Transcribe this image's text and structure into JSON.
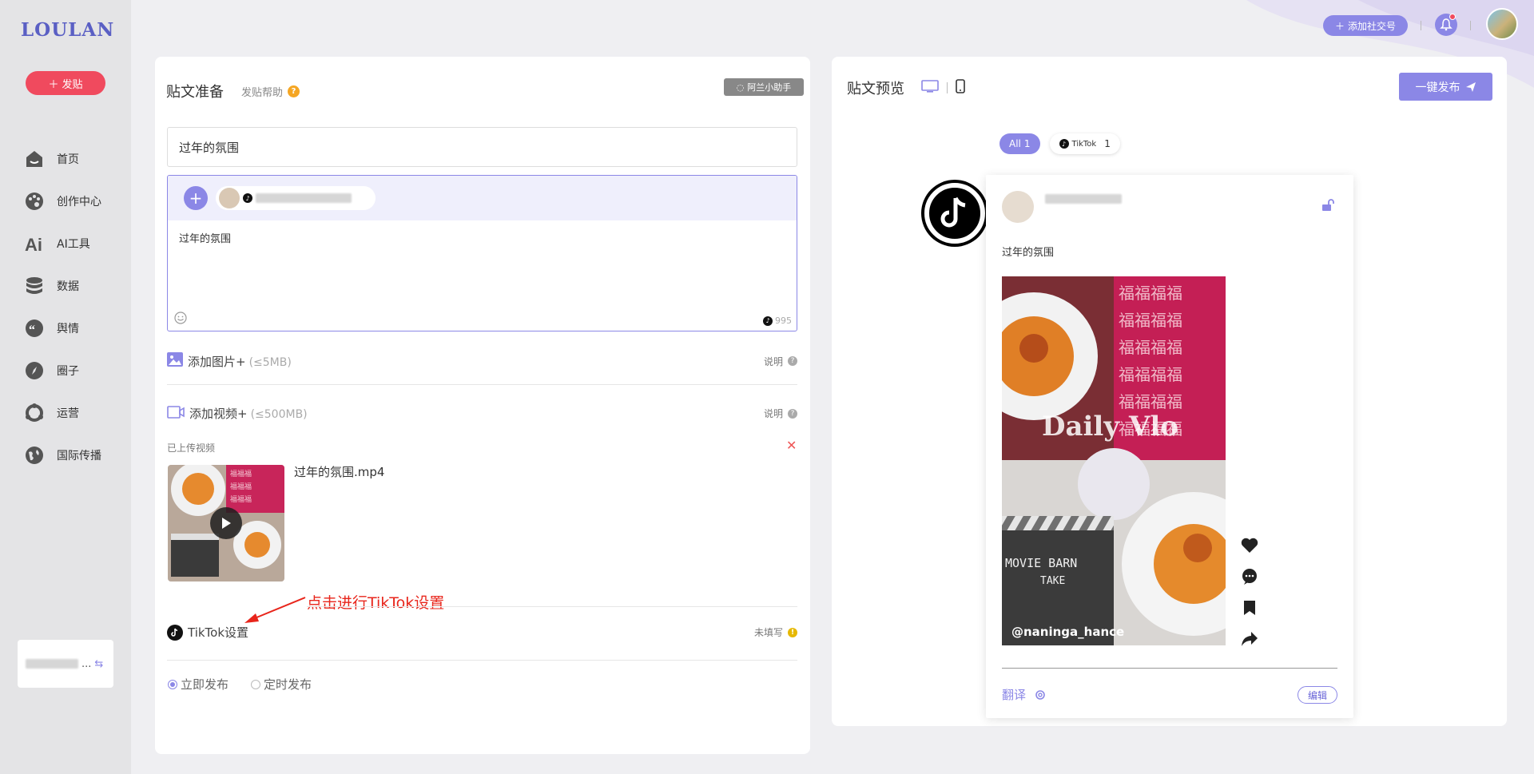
{
  "brand": {
    "logo": "LOULAN",
    "accent": "#8b87e6",
    "danger": "#f04a5e"
  },
  "sidebar": {
    "post_button": "发贴",
    "items": [
      {
        "label": "首页",
        "icon": "home-icon"
      },
      {
        "label": "创作中心",
        "icon": "palette-icon"
      },
      {
        "label": "AI工具",
        "icon": "ai-icon"
      },
      {
        "label": "数据",
        "icon": "database-icon"
      },
      {
        "label": "舆情",
        "icon": "quote-icon"
      },
      {
        "label": "圈子",
        "icon": "compass-icon"
      },
      {
        "label": "运营",
        "icon": "operations-icon"
      },
      {
        "label": "国际传播",
        "icon": "globe-icon"
      }
    ],
    "account_card": {
      "name": "...",
      "switch_icon": "switch-icon"
    }
  },
  "topbar": {
    "add_social_label": "添加社交号"
  },
  "compose": {
    "title": "贴文准备",
    "help": "发贴帮助",
    "assistant_button": "阿兰小助手",
    "title_value": "过年的氛围",
    "content_text": "过年的氛围",
    "char_count": "995",
    "add_image": {
      "label": "添加图片+",
      "limit": "(≤5MB)",
      "note": "说明"
    },
    "add_video": {
      "label": "添加视频+",
      "limit": "(≤500MB)",
      "note": "说明"
    },
    "uploaded_label": "已上传视频",
    "video_filename": "过年的氛围.mp4",
    "annotation": "点击进行TikTok设置",
    "tiktok_settings": {
      "label": "TikTok设置",
      "status": "未填写"
    },
    "publish_mode": {
      "now": "立即发布",
      "scheduled": "定时发布",
      "selected": "now"
    }
  },
  "preview": {
    "title": "贴文预览",
    "publish_button": "一键发布",
    "filters": [
      {
        "label": "All",
        "count": "1",
        "active": true
      },
      {
        "label": "TikTok",
        "count": "1",
        "active": false
      }
    ],
    "caption": "过年的氛围",
    "video_overlay": {
      "title": "Daily Vlo",
      "clapper": "MOVIE BARN",
      "take": "TAKE",
      "handle": "@naninga_hance"
    },
    "translate": "翻译",
    "edit": "编辑"
  }
}
